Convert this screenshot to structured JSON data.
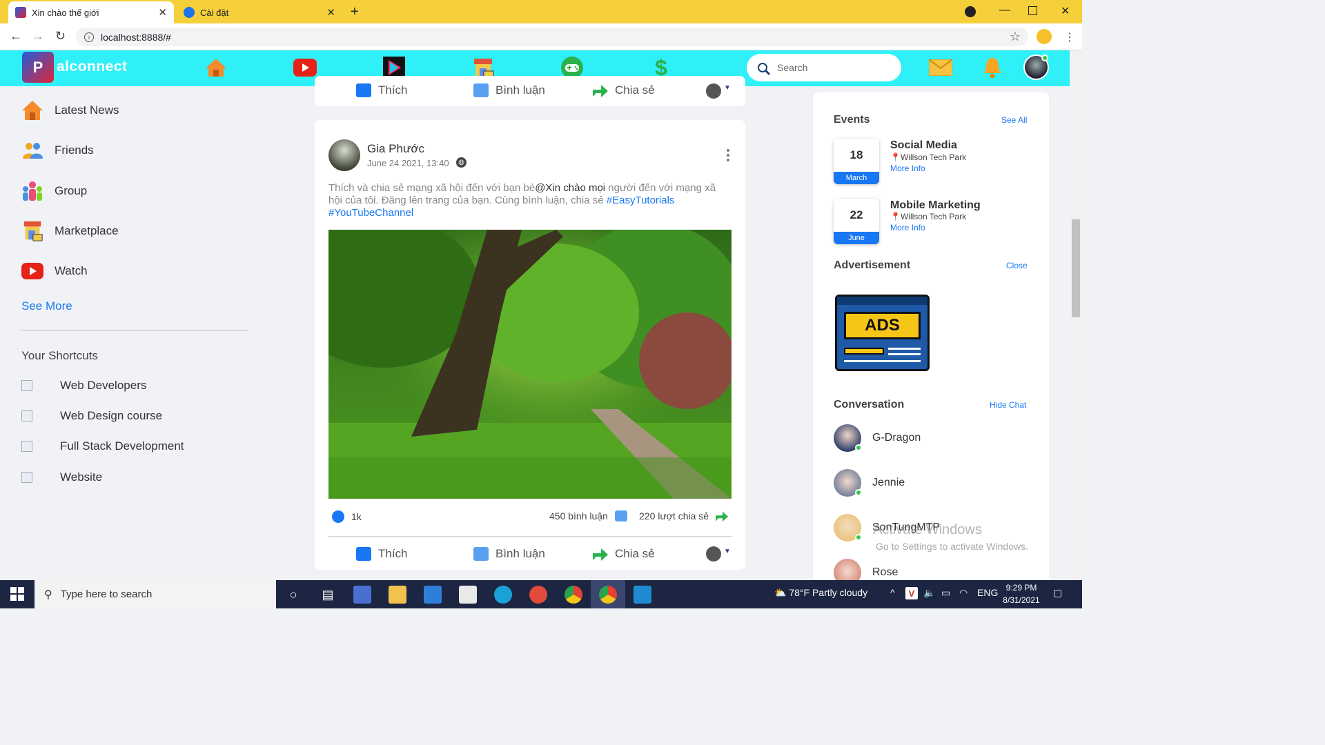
{
  "browser": {
    "tabs": [
      {
        "title": "Xin chào thế giới",
        "active": true
      },
      {
        "title": "Cài đặt",
        "active": false
      }
    ],
    "url": "localhost:8888/#"
  },
  "app": {
    "brand": "alconnect",
    "search_placeholder": "Search",
    "nav_icons": [
      "home-icon",
      "youtube-icon",
      "video-play-icon",
      "marketplace-icon",
      "gamepad-icon",
      "dollar-icon"
    ]
  },
  "sidebar": {
    "items": [
      {
        "label": "Latest News",
        "icon": "home-icon"
      },
      {
        "label": "Friends",
        "icon": "friends-icon"
      },
      {
        "label": "Group",
        "icon": "group-icon"
      },
      {
        "label": "Marketplace",
        "icon": "marketplace-icon"
      },
      {
        "label": "Watch",
        "icon": "youtube-icon"
      }
    ],
    "see_more": "See More",
    "shortcuts_title": "Your Shortcuts",
    "shortcuts": [
      "Web Developers",
      "Web Design course",
      "Full Stack Development",
      "Website"
    ]
  },
  "actions": {
    "like": "Thích",
    "comment": "Bình luận",
    "share": "Chia sẻ"
  },
  "post": {
    "author": "Gia Phước",
    "date": "June 24 2021, 13:40",
    "text_part1": "Thích và chia sẻ mạng xã hội đến với bạn bè",
    "mention": "@Xin chào mọi",
    "text_part2": " người đến với mạng xã hội của tôi. Đăng lên trang của bạn. Cùng bình luận, chia sẻ ",
    "hashtag1": "#EasyTutorials",
    "hashtag2": "#YouTubeChannel",
    "likes": "1k",
    "comments": "450 bình luận",
    "shares": "220 lượt chia sẻ"
  },
  "right": {
    "events_title": "Events",
    "see_all": "See All",
    "events": [
      {
        "day": "18",
        "month": "March",
        "title": "Social Media",
        "location": "Willson Tech Park",
        "more": "More Info"
      },
      {
        "day": "22",
        "month": "June",
        "title": "Mobile Marketing",
        "location": "Willson Tech Park",
        "more": "More Info"
      }
    ],
    "ad_title": "Advertisement",
    "ad_close": "Close",
    "ad_text": "ADS",
    "conv_title": "Conversation",
    "hide_chat": "Hide Chat",
    "contacts": [
      "G-Dragon",
      "Jennie",
      "SonTungMTP",
      "Rose"
    ]
  },
  "watermark": {
    "line1": "Activate Windows",
    "line2": "Go to Settings to activate Windows."
  },
  "taskbar": {
    "search_placeholder": "Type here to search",
    "weather": "78°F  Partly cloudy",
    "lang": "ENG",
    "time": "9:29 PM",
    "date": "8/31/2021"
  },
  "colors": {
    "header": "#2ff0f7",
    "tabbar": "#f6d03a",
    "link": "#1877f2",
    "online": "#31c94a",
    "taskbar": "#1c2541"
  }
}
